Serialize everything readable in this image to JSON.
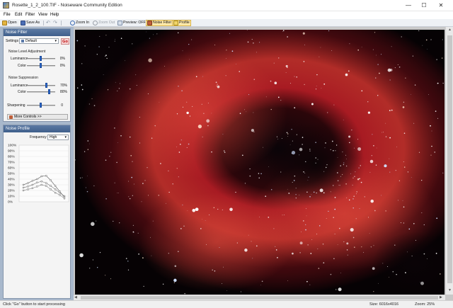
{
  "window": {
    "title": "Rosette_1_2_100.TIF - Noiseware Community Edition",
    "controls": {
      "minimize": "—",
      "maximize": "☐",
      "close": "✕"
    }
  },
  "menu": [
    "File",
    "Edit",
    "Filter",
    "View",
    "Help"
  ],
  "toolbar": {
    "open": "Open",
    "save_as": "Save As",
    "zoom_in": "Zoom In",
    "zoom_out": "Zoom Out",
    "preview": "Preview: OFF",
    "noise_filter": "Noise Filter",
    "profile": "Profile"
  },
  "noise_filter_panel": {
    "header": "Noise Filter",
    "settings_label": "Settings",
    "settings_value": "Default",
    "go_label": "Go",
    "level_group": "Noise Level Adjustment",
    "level": [
      {
        "label": "Luminance",
        "value": "0%",
        "fraction": 0.5
      },
      {
        "label": "Color",
        "value": "0%",
        "fraction": 0.5
      }
    ],
    "suppression_group": "Noise Suppression",
    "suppression": [
      {
        "label": "Luminance",
        "value": "70%",
        "fraction": 0.7
      },
      {
        "label": "Color",
        "value": "80%",
        "fraction": 0.8
      }
    ],
    "sharpening": {
      "label": "Sharpening",
      "value": "0",
      "fraction": 0.5
    },
    "more_controls": "More Controls >>"
  },
  "noise_profile_panel": {
    "header": "Noise Profile",
    "frequency_label": "Frequency",
    "frequency_value": "High",
    "y_ticks": [
      "100%",
      "90%",
      "80%",
      "70%",
      "60%",
      "50%",
      "40%",
      "30%",
      "20%",
      "10%",
      "0%"
    ],
    "profile_series": [
      {
        "values": [
          25,
          27,
          30,
          34,
          36,
          33,
          28,
          22,
          16,
          10
        ]
      },
      {
        "values": [
          30,
          33,
          37,
          40,
          45,
          46,
          38,
          28,
          18,
          8
        ]
      },
      {
        "values": [
          20,
          22,
          24,
          27,
          30,
          28,
          22,
          16,
          12,
          6
        ]
      }
    ]
  },
  "status": {
    "hint": "Click \"Go\" button to start processing",
    "size": "Size: 6016x4016",
    "zoom": "Zoom: 25%"
  },
  "icons": {
    "app": "app-icon",
    "open": "folder-icon",
    "save": "disk-icon",
    "undo": "undo-icon",
    "zoom_in": "magnifier-plus-icon",
    "zoom_out": "magnifier-minus-icon",
    "preview": "preview-icon",
    "noise_filter": "filter-icon",
    "profile": "profile-icon"
  },
  "colors": {
    "panel_header": "#3f5f8b",
    "left_background": "#a8b8cc",
    "slider_thumb": "#2f6fd6",
    "go_text": "#bb0000",
    "nebula_red": "#c8202a"
  }
}
